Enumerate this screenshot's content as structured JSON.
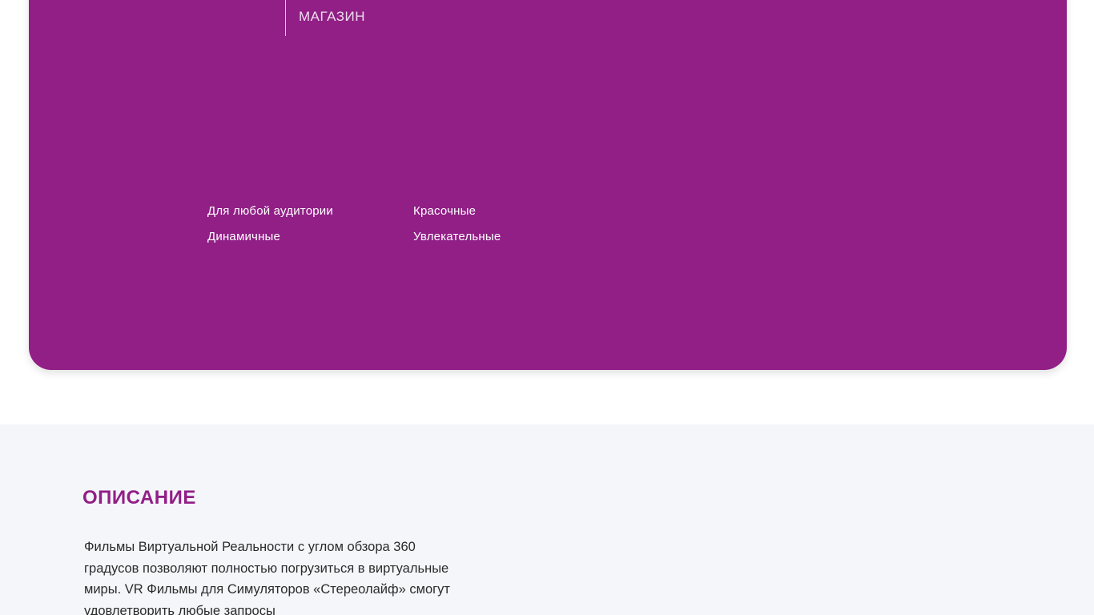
{
  "colors": {
    "brand": "#911f86",
    "section_bg": "#f5f6fa",
    "text_dark": "#2b2b2b"
  },
  "nav": {
    "shop_label": "МАГАЗИН"
  },
  "features": [
    "Для любой аудитории",
    "Красочные",
    "Динамичные",
    "Увлекательные"
  ],
  "description": {
    "title": "ОПИСАНИЕ",
    "text": "Фильмы Виртуальной Реальности с углом обзора 360 градусов позволяют полностью погрузиться в виртуальные миры. VR Фильмы для Симуляторов «Стереолайф» смогут удовлетворить любые запросы"
  }
}
